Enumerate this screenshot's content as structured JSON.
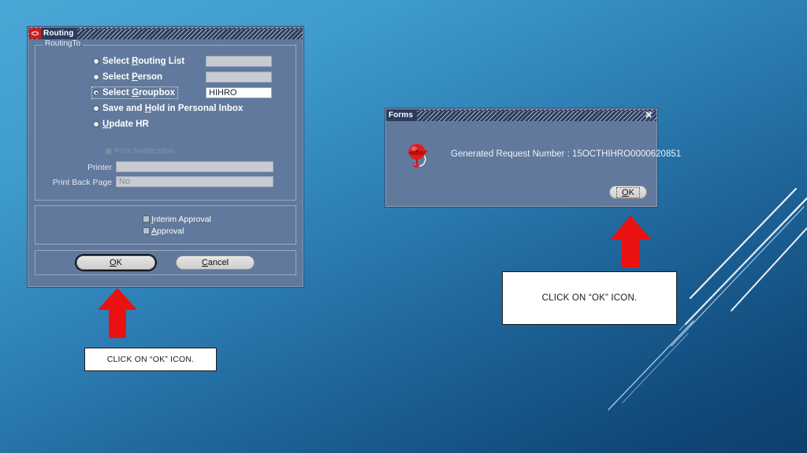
{
  "desktop": {
    "background_top_color": "#4aa7d6",
    "background_bottom_color": "#0d3f6c"
  },
  "routing_window": {
    "title": "Routing",
    "icon": "oracle-icon",
    "groupbox_label": "RoutingTo",
    "options": [
      {
        "label_pre": "Select ",
        "label_key": "R",
        "label_post": "outing List",
        "selected": false,
        "focused": false,
        "field_value": "",
        "field_style": "grey"
      },
      {
        "label_pre": "Select ",
        "label_key": "P",
        "label_post": "erson",
        "selected": false,
        "focused": false,
        "field_value": "",
        "field_style": "grey"
      },
      {
        "label_pre": "Select ",
        "label_key": "G",
        "label_post": "roupbox",
        "selected": true,
        "focused": true,
        "field_value": "HIHRO",
        "field_style": "white"
      },
      {
        "label_pre": "Save and ",
        "label_key": "H",
        "label_post": "old in Personal Inbox",
        "selected": false,
        "focused": false,
        "field_value": null,
        "field_style": "none"
      },
      {
        "label_pre": "",
        "label_key": "U",
        "label_post": "pdate HR",
        "selected": false,
        "focused": false,
        "field_value": null,
        "field_style": "none"
      }
    ],
    "print_notification": {
      "label": "Print Notification",
      "checked": false,
      "disabled": true
    },
    "printer": {
      "label": "Printer",
      "value": ""
    },
    "print_back_page": {
      "label": "Print Back Page",
      "value": "No"
    },
    "approvals": [
      {
        "label_key": "I",
        "label_post": "nterim Approval",
        "checked": false
      },
      {
        "label_key": "A",
        "label_post": "pproval",
        "checked": false
      }
    ],
    "buttons": {
      "ok": {
        "pre": "",
        "key": "O",
        "post": "K",
        "default": true
      },
      "cancel": {
        "pre": "",
        "key": "C",
        "post": "ancel",
        "default": false
      }
    }
  },
  "forms_window": {
    "title": "Forms",
    "close_glyph": "✕",
    "icon": "alarm-bell-icon",
    "message": "Generated Request Number : 15OCTHIHRO0000620851",
    "ok_button": {
      "pre": "",
      "key": "O",
      "post": "K"
    }
  },
  "callouts": [
    {
      "id": "left",
      "text": "CLICK ON “OK” ICON."
    },
    {
      "id": "right",
      "text": "CLICK ON “OK” ICON."
    }
  ],
  "arrows": [
    {
      "id": "left-arrow",
      "color": "#e81313",
      "direction": "up"
    },
    {
      "id": "right-arrow",
      "color": "#e81313",
      "direction": "up"
    }
  ]
}
